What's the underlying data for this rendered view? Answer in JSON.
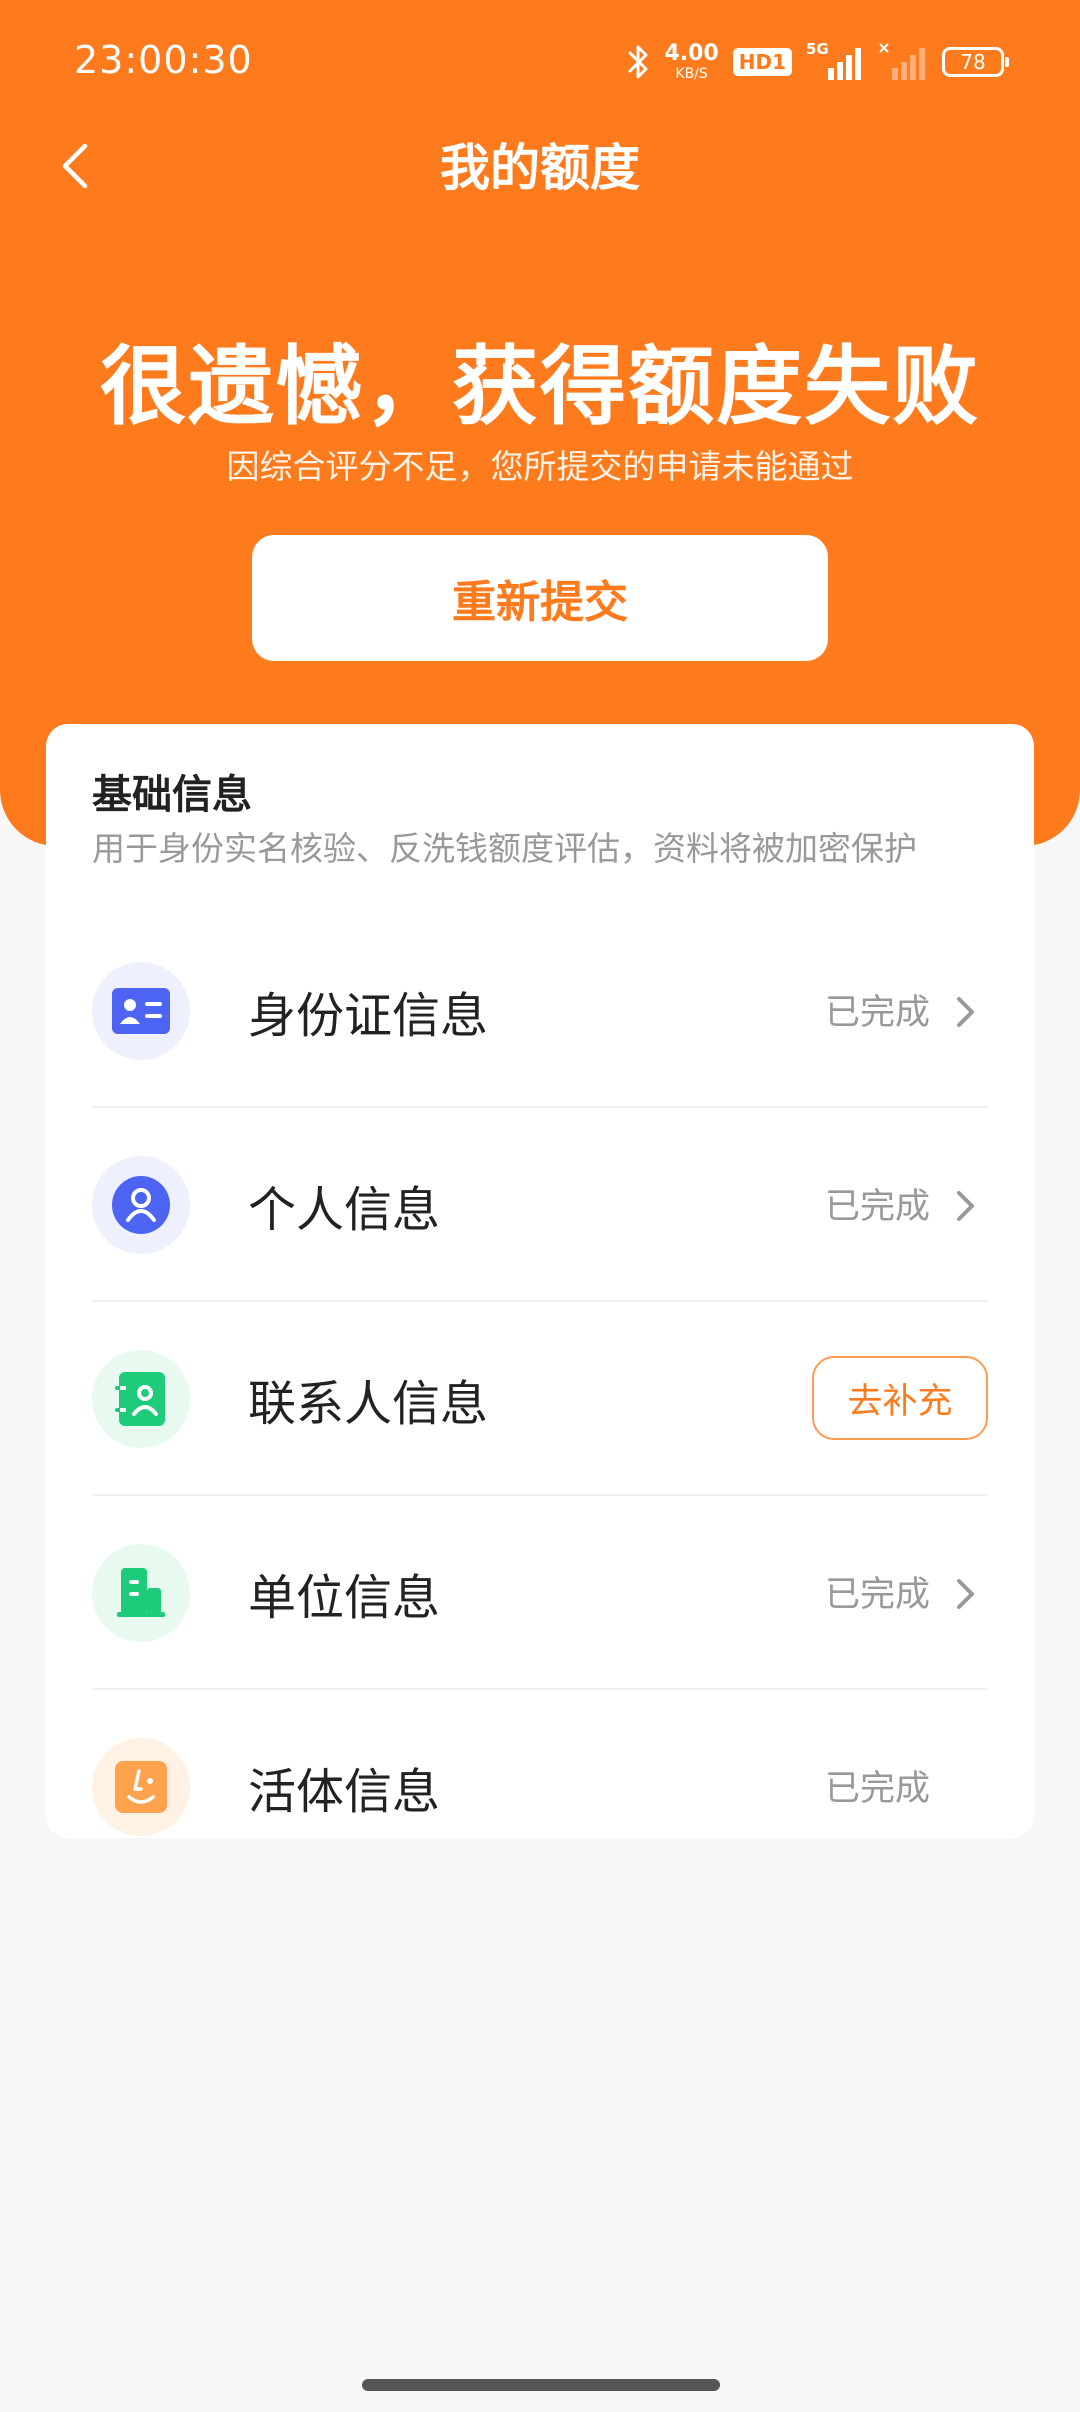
{
  "status_bar": {
    "time": "23:00:30",
    "net_speed_value": "4.00",
    "net_speed_unit": "KB/S",
    "hd_label": "HD1",
    "network_label": "5G",
    "battery": "78"
  },
  "nav": {
    "title": "我的额度"
  },
  "hero": {
    "title": "很遗憾，获得额度失败",
    "subtitle": "因综合评分不足，您所提交的申请未能通过",
    "button_label": "重新提交"
  },
  "basic_info": {
    "title": "基础信息",
    "subtitle": "用于身份实名核验、反洗钱额度评估，资料将被加密保护",
    "items": [
      {
        "label": "身份证信息",
        "status": "已完成",
        "icon": "id-card-icon"
      },
      {
        "label": "个人信息",
        "status": "已完成",
        "icon": "person-icon"
      },
      {
        "label": "联系人信息",
        "action": "去补充",
        "icon": "contacts-icon"
      },
      {
        "label": "单位信息",
        "status": "已完成",
        "icon": "building-icon"
      },
      {
        "label": "活体信息",
        "status": "已完成",
        "icon": "face-icon"
      }
    ]
  },
  "colors": {
    "brand": "#fe7b1d",
    "text_primary": "#222222",
    "text_secondary": "#999999",
    "id_card_icon": "#4d63f2",
    "person_icon": "#4d63f2",
    "contacts_icon": "#1ecb7b",
    "building_icon": "#1ecb7b",
    "face_icon": "#fea24d"
  }
}
